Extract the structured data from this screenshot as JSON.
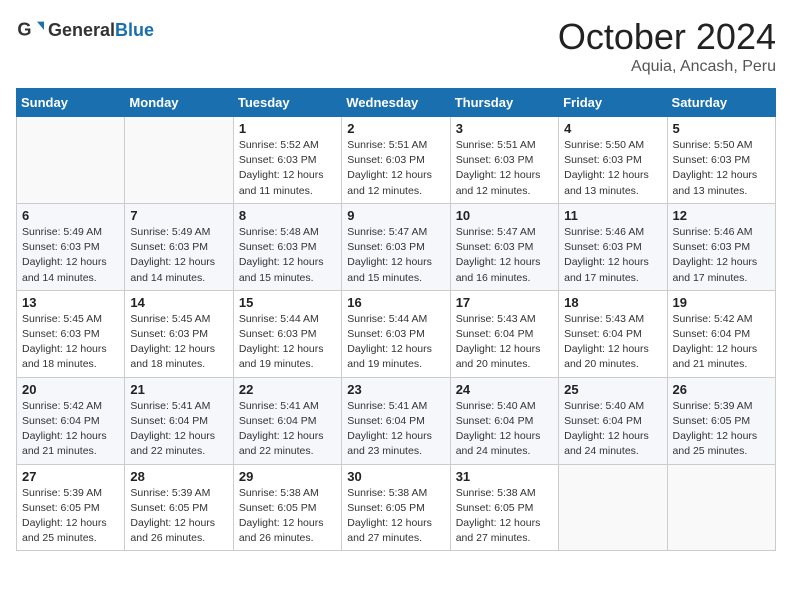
{
  "header": {
    "logo_general": "General",
    "logo_blue": "Blue",
    "month": "October 2024",
    "location": "Aquia, Ancash, Peru"
  },
  "weekdays": [
    "Sunday",
    "Monday",
    "Tuesday",
    "Wednesday",
    "Thursday",
    "Friday",
    "Saturday"
  ],
  "weeks": [
    [
      {
        "day": "",
        "detail": ""
      },
      {
        "day": "",
        "detail": ""
      },
      {
        "day": "1",
        "detail": "Sunrise: 5:52 AM\nSunset: 6:03 PM\nDaylight: 12 hours\nand 11 minutes."
      },
      {
        "day": "2",
        "detail": "Sunrise: 5:51 AM\nSunset: 6:03 PM\nDaylight: 12 hours\nand 12 minutes."
      },
      {
        "day": "3",
        "detail": "Sunrise: 5:51 AM\nSunset: 6:03 PM\nDaylight: 12 hours\nand 12 minutes."
      },
      {
        "day": "4",
        "detail": "Sunrise: 5:50 AM\nSunset: 6:03 PM\nDaylight: 12 hours\nand 13 minutes."
      },
      {
        "day": "5",
        "detail": "Sunrise: 5:50 AM\nSunset: 6:03 PM\nDaylight: 12 hours\nand 13 minutes."
      }
    ],
    [
      {
        "day": "6",
        "detail": "Sunrise: 5:49 AM\nSunset: 6:03 PM\nDaylight: 12 hours\nand 14 minutes."
      },
      {
        "day": "7",
        "detail": "Sunrise: 5:49 AM\nSunset: 6:03 PM\nDaylight: 12 hours\nand 14 minutes."
      },
      {
        "day": "8",
        "detail": "Sunrise: 5:48 AM\nSunset: 6:03 PM\nDaylight: 12 hours\nand 15 minutes."
      },
      {
        "day": "9",
        "detail": "Sunrise: 5:47 AM\nSunset: 6:03 PM\nDaylight: 12 hours\nand 15 minutes."
      },
      {
        "day": "10",
        "detail": "Sunrise: 5:47 AM\nSunset: 6:03 PM\nDaylight: 12 hours\nand 16 minutes."
      },
      {
        "day": "11",
        "detail": "Sunrise: 5:46 AM\nSunset: 6:03 PM\nDaylight: 12 hours\nand 17 minutes."
      },
      {
        "day": "12",
        "detail": "Sunrise: 5:46 AM\nSunset: 6:03 PM\nDaylight: 12 hours\nand 17 minutes."
      }
    ],
    [
      {
        "day": "13",
        "detail": "Sunrise: 5:45 AM\nSunset: 6:03 PM\nDaylight: 12 hours\nand 18 minutes."
      },
      {
        "day": "14",
        "detail": "Sunrise: 5:45 AM\nSunset: 6:03 PM\nDaylight: 12 hours\nand 18 minutes."
      },
      {
        "day": "15",
        "detail": "Sunrise: 5:44 AM\nSunset: 6:03 PM\nDaylight: 12 hours\nand 19 minutes."
      },
      {
        "day": "16",
        "detail": "Sunrise: 5:44 AM\nSunset: 6:03 PM\nDaylight: 12 hours\nand 19 minutes."
      },
      {
        "day": "17",
        "detail": "Sunrise: 5:43 AM\nSunset: 6:04 PM\nDaylight: 12 hours\nand 20 minutes."
      },
      {
        "day": "18",
        "detail": "Sunrise: 5:43 AM\nSunset: 6:04 PM\nDaylight: 12 hours\nand 20 minutes."
      },
      {
        "day": "19",
        "detail": "Sunrise: 5:42 AM\nSunset: 6:04 PM\nDaylight: 12 hours\nand 21 minutes."
      }
    ],
    [
      {
        "day": "20",
        "detail": "Sunrise: 5:42 AM\nSunset: 6:04 PM\nDaylight: 12 hours\nand 21 minutes."
      },
      {
        "day": "21",
        "detail": "Sunrise: 5:41 AM\nSunset: 6:04 PM\nDaylight: 12 hours\nand 22 minutes."
      },
      {
        "day": "22",
        "detail": "Sunrise: 5:41 AM\nSunset: 6:04 PM\nDaylight: 12 hours\nand 22 minutes."
      },
      {
        "day": "23",
        "detail": "Sunrise: 5:41 AM\nSunset: 6:04 PM\nDaylight: 12 hours\nand 23 minutes."
      },
      {
        "day": "24",
        "detail": "Sunrise: 5:40 AM\nSunset: 6:04 PM\nDaylight: 12 hours\nand 24 minutes."
      },
      {
        "day": "25",
        "detail": "Sunrise: 5:40 AM\nSunset: 6:04 PM\nDaylight: 12 hours\nand 24 minutes."
      },
      {
        "day": "26",
        "detail": "Sunrise: 5:39 AM\nSunset: 6:05 PM\nDaylight: 12 hours\nand 25 minutes."
      }
    ],
    [
      {
        "day": "27",
        "detail": "Sunrise: 5:39 AM\nSunset: 6:05 PM\nDaylight: 12 hours\nand 25 minutes."
      },
      {
        "day": "28",
        "detail": "Sunrise: 5:39 AM\nSunset: 6:05 PM\nDaylight: 12 hours\nand 26 minutes."
      },
      {
        "day": "29",
        "detail": "Sunrise: 5:38 AM\nSunset: 6:05 PM\nDaylight: 12 hours\nand 26 minutes."
      },
      {
        "day": "30",
        "detail": "Sunrise: 5:38 AM\nSunset: 6:05 PM\nDaylight: 12 hours\nand 27 minutes."
      },
      {
        "day": "31",
        "detail": "Sunrise: 5:38 AM\nSunset: 6:05 PM\nDaylight: 12 hours\nand 27 minutes."
      },
      {
        "day": "",
        "detail": ""
      },
      {
        "day": "",
        "detail": ""
      }
    ]
  ]
}
